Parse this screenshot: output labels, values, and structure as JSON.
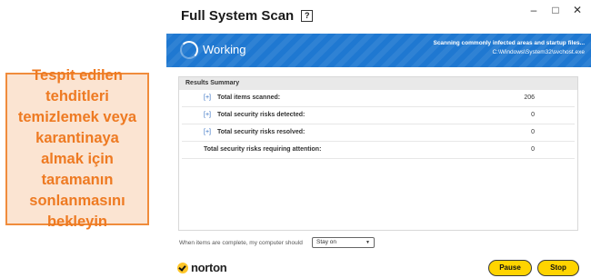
{
  "callout": {
    "text": "Tespit edilen tehditleri temizlemek veya karantinaya almak için taramanın sonlanmasını bekleyin"
  },
  "window": {
    "title": "Full System Scan",
    "help_glyph": "?",
    "controls": {
      "minimize": "–",
      "maximize": "□",
      "close": "✕"
    }
  },
  "banner": {
    "status": "Working",
    "message": "Scanning commonly infected areas and startup files...",
    "path": "C:\\Windows\\System32\\svchost.exe",
    "color": "#1f78d1"
  },
  "results": {
    "header": "Results Summary",
    "rows": [
      {
        "expander": "[+]",
        "label": "Total items scanned:",
        "value": "206"
      },
      {
        "expander": "[+]",
        "label": "Total security risks detected:",
        "value": "0"
      },
      {
        "expander": "[+]",
        "label": "Total security risks resolved:",
        "value": "0"
      },
      {
        "expander": "",
        "label": "Total security risks requiring attention:",
        "value": "0"
      }
    ]
  },
  "footer": {
    "completion_label": "When items are complete, my computer should",
    "completion_value": "Stay on",
    "brand": "norton",
    "pause_label": "Pause",
    "stop_label": "Stop",
    "accent": "#ffd400"
  }
}
